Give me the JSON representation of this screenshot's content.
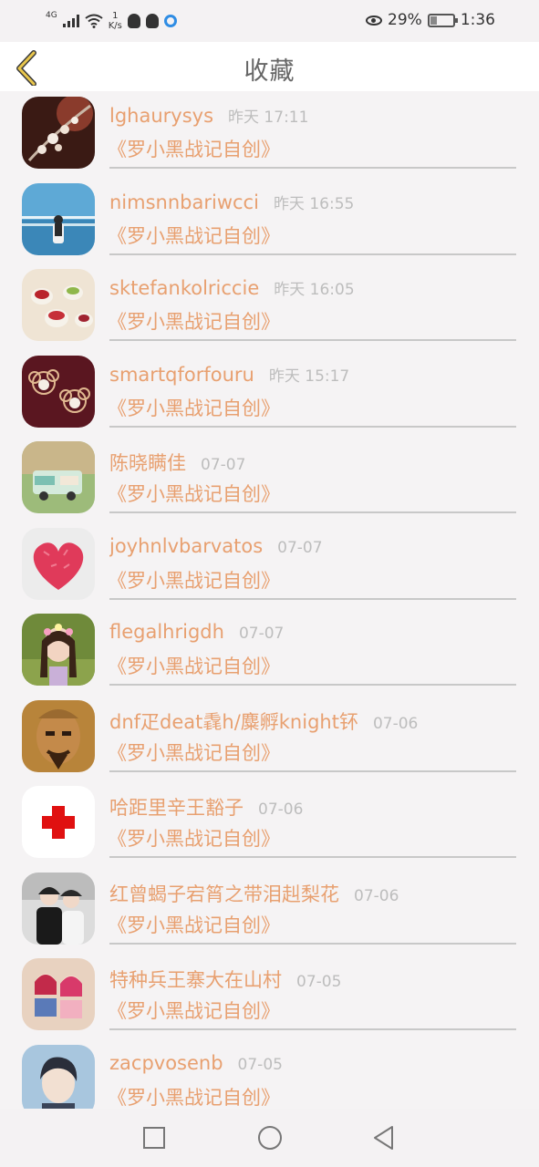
{
  "status_bar": {
    "network": "4G",
    "speed_value": "1",
    "speed_unit": "K/s",
    "battery_percent": "29%",
    "battery_level": 0.29,
    "time": "1:36",
    "icons": [
      "signal-icon",
      "wifi-icon",
      "qq-icon",
      "app-icon",
      "browser-icon",
      "eye-icon",
      "battery-icon"
    ]
  },
  "header": {
    "title": "收藏",
    "back_icon": "chevron-left-icon",
    "accent_color": "#e8c64c"
  },
  "colors": {
    "name": "#e8a070",
    "time": "#bdbdbd",
    "divider": "#c8c8c8"
  },
  "favorites": [
    {
      "name": "lghaurysys",
      "time": "昨天 17:11",
      "book": "《罗小黑战记自创》",
      "avatar": "flower-branch-photo"
    },
    {
      "name": "nimsnnbariwcci",
      "time": "昨天 16:55",
      "book": "《罗小黑战记自创》",
      "avatar": "girl-by-sea-photo"
    },
    {
      "name": "sktefankolriccie",
      "time": "昨天 16:05",
      "book": "《罗小黑战记自创》",
      "avatar": "candles-photo"
    },
    {
      "name": "smartqforfouru",
      "time": "昨天 15:17",
      "book": "《罗小黑战记自创》",
      "avatar": "pearl-earrings-photo"
    },
    {
      "name": "陈晓瞒佳",
      "time": "07-07",
      "book": "《罗小黑战记自创》",
      "avatar": "toy-van-photo"
    },
    {
      "name": "joyhnlvbarvatos",
      "time": "07-07",
      "book": "《罗小黑战记自创》",
      "avatar": "petal-heart-photo"
    },
    {
      "name": "flegalhrigdh",
      "time": "07-07",
      "book": "《罗小黑战记自创》",
      "avatar": "girl-flower-crown-photo"
    },
    {
      "name": "dnf疋deat毳h/麋孵knight钚",
      "time": "07-06",
      "book": "《罗小黑战记自创》",
      "avatar": "bald-man-art"
    },
    {
      "name": "哈距里辛王豁子",
      "time": "07-06",
      "book": "《罗小黑战记自创》",
      "avatar": "red-cross-icon"
    },
    {
      "name": "红曾蝎子宕筲之带泪赳梨花",
      "time": "07-06",
      "book": "《罗小黑战记自创》",
      "avatar": "couple-photo"
    },
    {
      "name": "特种兵王寨大在山村",
      "time": "07-05",
      "book": "《罗小黑战记自创》",
      "avatar": "two-girls-photo"
    },
    {
      "name": "zacpvosenb",
      "time": "07-05",
      "book": "《罗小黑战记自创》",
      "avatar": "boy-portrait-photo"
    }
  ],
  "nav_bar": {
    "recents_icon": "square-icon",
    "home_icon": "circle-icon",
    "back_icon": "triangle-back-icon"
  }
}
